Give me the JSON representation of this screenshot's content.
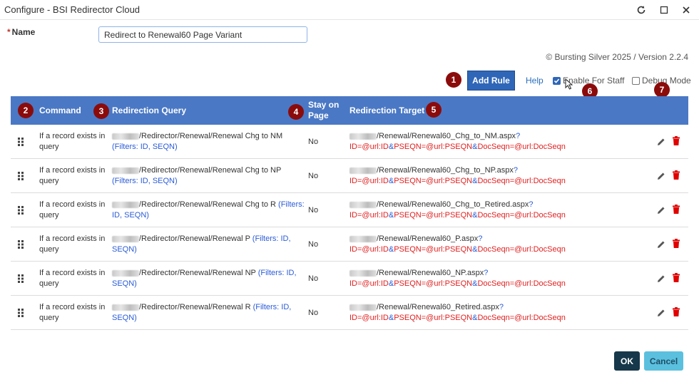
{
  "window": {
    "title": "Configure - BSI Redirector Cloud",
    "refresh_icon": "refresh-icon",
    "maximize_icon": "maximize-icon",
    "close_icon": "close-icon"
  },
  "form": {
    "name_label": "Name",
    "required_mark": "*",
    "name_value": "Redirect to Renewal60 Page Variant",
    "version": "© Bursting Silver 2025 / Version 2.2.4"
  },
  "toolbar": {
    "add_rule_label": "Add Rule",
    "help_label": "Help",
    "enable_for_staff_label": "Enable For Staff",
    "enable_for_staff_checked": true,
    "debug_mode_label": "Debug Mode",
    "debug_mode_checked": false
  },
  "badges": [
    "1",
    "2",
    "3",
    "4",
    "5",
    "6",
    "7"
  ],
  "grid": {
    "headers": {
      "command": "Command",
      "query": "Redirection Query",
      "stay_line1": "Stay on",
      "stay_line2": "Page",
      "target": "Redirection Target"
    },
    "rows": [
      {
        "command": "If a record exists in query",
        "query_path": "/Redirector/Renewal/Renewal Chg to NM",
        "query_filters": "(Filters: ID, SEQN)",
        "stay": "No",
        "target_path": "/Renewal/Renewal60_Chg_to_NM.aspx",
        "target_q": "?"
      },
      {
        "command": "If a record exists in query",
        "query_path": "/Redirector/Renewal/Renewal Chg to NP",
        "query_filters": "(Filters: ID, SEQN)",
        "stay": "No",
        "target_path": "/Renewal/Renewal60_Chg_to_NP.aspx",
        "target_q": "?"
      },
      {
        "command": "If a record exists in query",
        "query_path": "/Redirector/Renewal/Renewal Chg to R",
        "query_filters": "(Filters: ID, SEQN)",
        "stay": "No",
        "target_path": "/Renewal/Renewal60_Chg_to_Retired.aspx",
        "target_q": "?"
      },
      {
        "command": "If a record exists in query",
        "query_path": "/Redirector/Renewal/Renewal P",
        "query_filters": "(Filters: ID, SEQN)",
        "stay": "No",
        "target_path": "/Renewal/Renewal60_P.aspx",
        "target_q": "?"
      },
      {
        "command": "If a record exists in query",
        "query_path": "/Redirector/Renewal/Renewal NP",
        "query_filters": "(Filters: ID, SEQN)",
        "stay": "No",
        "target_path": "/Renewal/Renewal60_NP.aspx",
        "target_q": "?"
      },
      {
        "command": "If a record exists in query",
        "query_path": "/Redirector/Renewal/Renewal R",
        "query_filters": "(Filters: ID, SEQN)",
        "stay": "No",
        "target_path": "/Renewal/Renewal60_Retired.aspx",
        "target_q": "?"
      }
    ],
    "target_params": {
      "p1": "ID=@url:ID",
      "amp1": "&",
      "p2": "PSEQN=@url:PSEQN",
      "amp2": "&",
      "p3": "DocSeqn=@url:DocSeqn"
    }
  },
  "footer": {
    "ok_label": "OK",
    "cancel_label": "Cancel"
  },
  "colors": {
    "header_bg": "#4a78c5",
    "badge": "#8b0b0b",
    "add_rule_bg": "#2f66b8",
    "ok_bg": "#16384a",
    "cancel_bg": "#5bc0de",
    "delete_icon": "#e00000",
    "link_blue": "#2a5bd7",
    "param_red": "#e02020"
  }
}
